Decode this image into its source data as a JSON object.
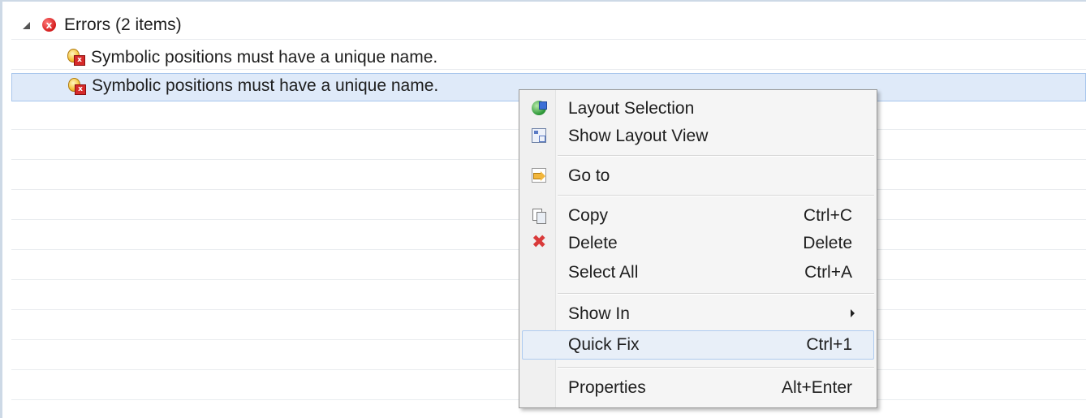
{
  "tree": {
    "group": {
      "label": "Errors (2 items)",
      "expanded": true
    },
    "items": [
      {
        "label": "Symbolic positions must have a unique name.",
        "selected": false
      },
      {
        "label": "Symbolic positions must have a unique name.",
        "selected": true
      }
    ]
  },
  "context_menu": {
    "items": [
      {
        "label": "Layout Selection",
        "shortcut": "",
        "icon": "layout-selection-icon"
      },
      {
        "label": "Show Layout View",
        "shortcut": "",
        "icon": "show-layout-view-icon"
      },
      {
        "label": "Go to",
        "shortcut": "",
        "icon": "go-to-icon"
      },
      {
        "label": "Copy",
        "shortcut": "Ctrl+C",
        "icon": "copy-icon"
      },
      {
        "label": "Delete",
        "shortcut": "Delete",
        "icon": "delete-icon"
      },
      {
        "label": "Select All",
        "shortcut": "Ctrl+A",
        "icon": ""
      },
      {
        "label": "Show In",
        "shortcut": "",
        "icon": "",
        "submenu": true
      },
      {
        "label": "Quick Fix",
        "shortcut": "Ctrl+1",
        "icon": "",
        "hovered": true
      },
      {
        "label": "Properties",
        "shortcut": "Alt+Enter",
        "icon": ""
      }
    ]
  },
  "colors": {
    "selection_bg": "#dfeaf9",
    "selection_border": "#a8c6ec",
    "menu_bg": "#f5f5f5",
    "error_red": "#d41b1b"
  }
}
